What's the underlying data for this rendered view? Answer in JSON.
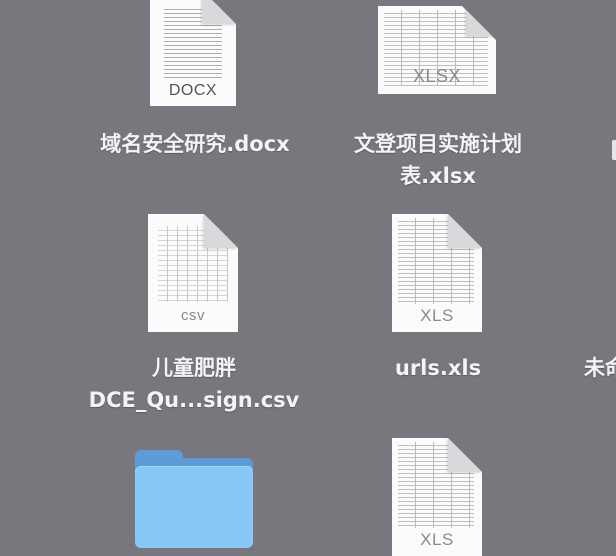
{
  "desktop": {
    "items": [
      {
        "label": "域名安全研究.docx",
        "type_tag": "DOCX"
      },
      {
        "label_line1": "文登项目实施计划",
        "label_line2": "表.xlsx",
        "type_tag": "XLSX"
      },
      {
        "label_line1": "儿童肥胖",
        "label_line2": "DCE_Qu...sign.csv",
        "type_tag": "csv"
      },
      {
        "label": "urls.xls",
        "type_tag": "XLS"
      },
      {
        "label": "未命",
        "type_tag": ""
      },
      {
        "label": "",
        "type_tag": ""
      },
      {
        "label": "",
        "type_tag": "XLS"
      }
    ]
  }
}
